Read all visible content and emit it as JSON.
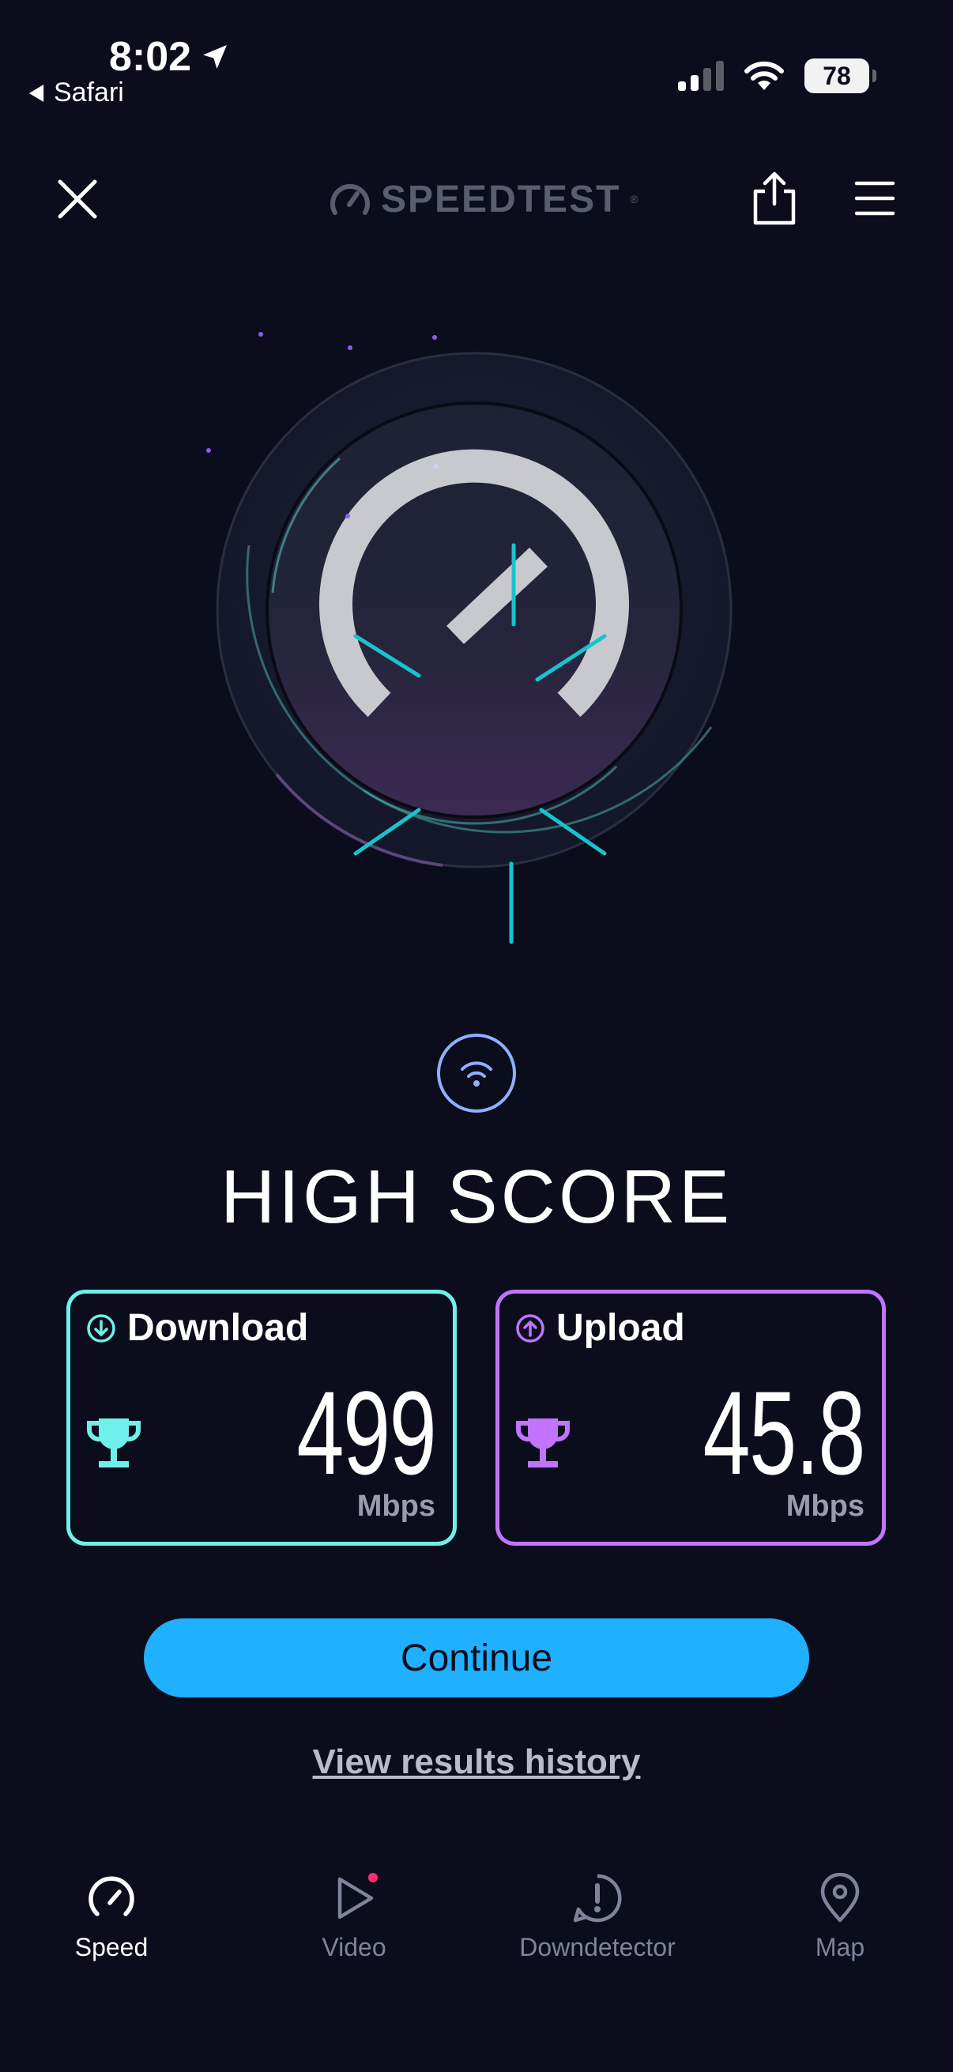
{
  "status_bar": {
    "time": "8:02",
    "back_app": "Safari",
    "battery": "78"
  },
  "header": {
    "brand": "SPEEDTEST",
    "trademark": "®"
  },
  "result": {
    "title": "HIGH SCORE",
    "download": {
      "label": "Download",
      "value": "499",
      "unit": "Mbps"
    },
    "upload": {
      "label": "Upload",
      "value": "45.8",
      "unit": "Mbps"
    }
  },
  "actions": {
    "continue": "Continue",
    "history": "View results history"
  },
  "tabs": [
    {
      "label": "Speed",
      "icon": "speed-icon",
      "active": true
    },
    {
      "label": "Video",
      "icon": "video-icon",
      "active": false
    },
    {
      "label": "Downdetector",
      "icon": "downdetector-icon",
      "active": false
    },
    {
      "label": "Map",
      "icon": "map-pin-icon",
      "active": false
    }
  ],
  "colors": {
    "background": "#0b0d1d",
    "download_accent": "#6ff0ea",
    "upload_accent": "#c274ff",
    "primary_button": "#1fb0ff",
    "gauge_tick": "#18c3cc"
  }
}
